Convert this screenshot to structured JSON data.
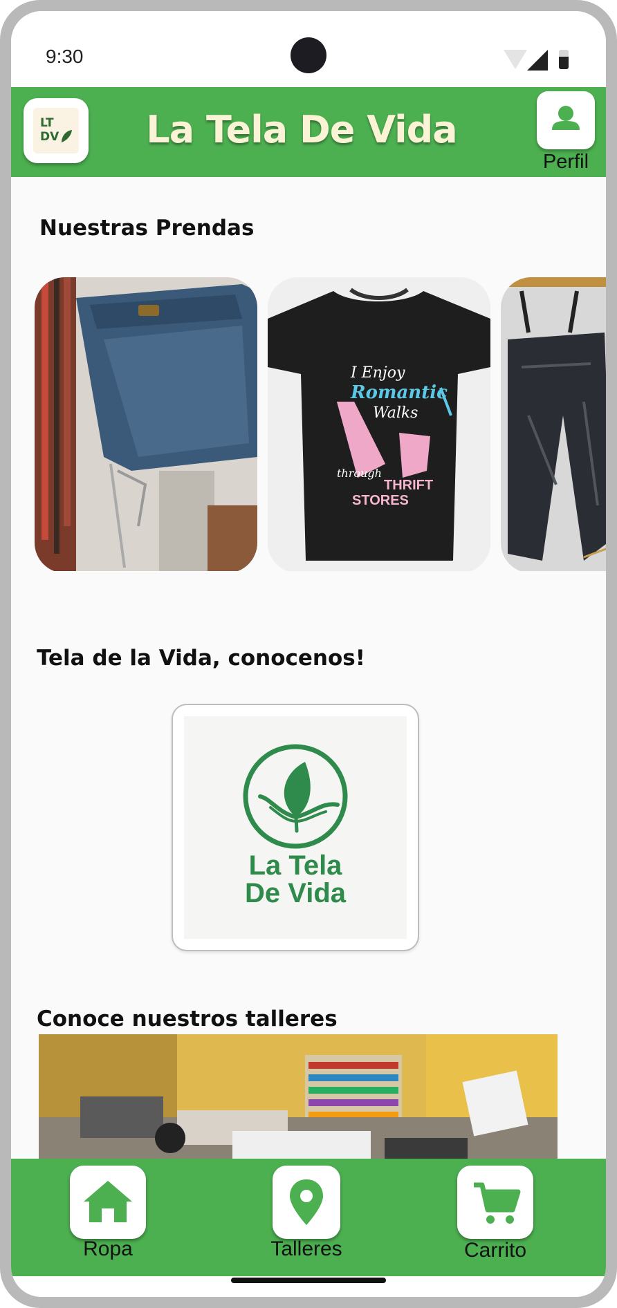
{
  "status": {
    "time": "9:30"
  },
  "header": {
    "logo_text": "LT DV",
    "title": "La Tela De Vida",
    "profile_label": "Perfil"
  },
  "sections": {
    "prendas_title": "Nuestras Prendas",
    "about_title": "Tela de la Vida, conocenos!",
    "talleres_title": "Conoce nuestros talleres"
  },
  "products": [
    {
      "name": "denim-skirt"
    },
    {
      "name": "tshirt",
      "print_lines": [
        "I Enjoy",
        "Romantic",
        "Walks",
        "through",
        "THRIFT",
        "STORES"
      ]
    },
    {
      "name": "overalls"
    }
  ],
  "about": {
    "brand_line1": "La Tela",
    "brand_line2": "De Vida"
  },
  "nav": [
    {
      "label": "Ropa",
      "icon": "home-icon"
    },
    {
      "label": "Talleres",
      "icon": "map-pin-icon"
    },
    {
      "label": "Carrito",
      "icon": "cart-icon"
    }
  ],
  "colors": {
    "primary": "#4caf50",
    "brand_green": "#2e8b4b",
    "title_cream": "#fbf3d6"
  }
}
